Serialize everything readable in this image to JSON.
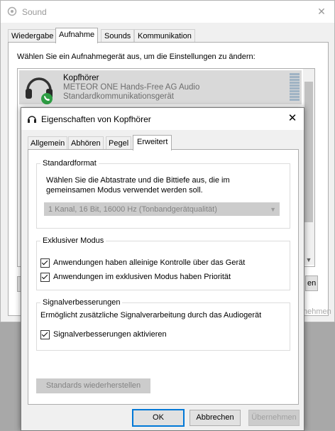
{
  "sound": {
    "title": "Sound",
    "close_glyph": "✕",
    "tabs": [
      "Wiedergabe",
      "Aufnahme",
      "Sounds",
      "Kommunikation"
    ],
    "instruction": "Wählen Sie ein Aufnahmegerät aus, um die Einstellungen zu ändern:",
    "device": {
      "name": "Kopfhörer",
      "description": "METEOR ONE Hands-Free AG Audio",
      "status": "Standardkommunikationsgerät",
      "icon": "headset-icon"
    },
    "partial_button_right": "en",
    "partial_apply": "nehmen"
  },
  "props": {
    "title": "Eigenschaften von Kopfhörer",
    "close_glyph": "✕",
    "tabs": [
      "Allgemein",
      "Abhören",
      "Pegel",
      "Erweitert"
    ],
    "default_format": {
      "title": "Standardformat",
      "description": "Wählen Sie die Abtastrate und die Bittiefe aus, die im gemeinsamen Modus verwendet werden soll.",
      "selected": "1 Kanal, 16 Bit, 16000 Hz (Tonbandgerätqualität)"
    },
    "exclusive": {
      "title": "Exklusiver Modus",
      "option1": "Anwendungen haben alleinige Kontrolle über das Gerät",
      "option2": "Anwendungen im exklusiven Modus haben Priorität"
    },
    "enhancements": {
      "title": "Signalverbesserungen",
      "description": "Ermöglicht zusätzliche Signalverarbeitung durch das Audiogerät",
      "option": "Signalverbesserungen aktivieren"
    },
    "restore": "Standards wiederherstellen",
    "ok": "OK",
    "cancel": "Abbrechen",
    "apply": "Übernehmen"
  },
  "colors": {
    "accent": "#0078d7",
    "badge_green": "#2e9e44"
  }
}
